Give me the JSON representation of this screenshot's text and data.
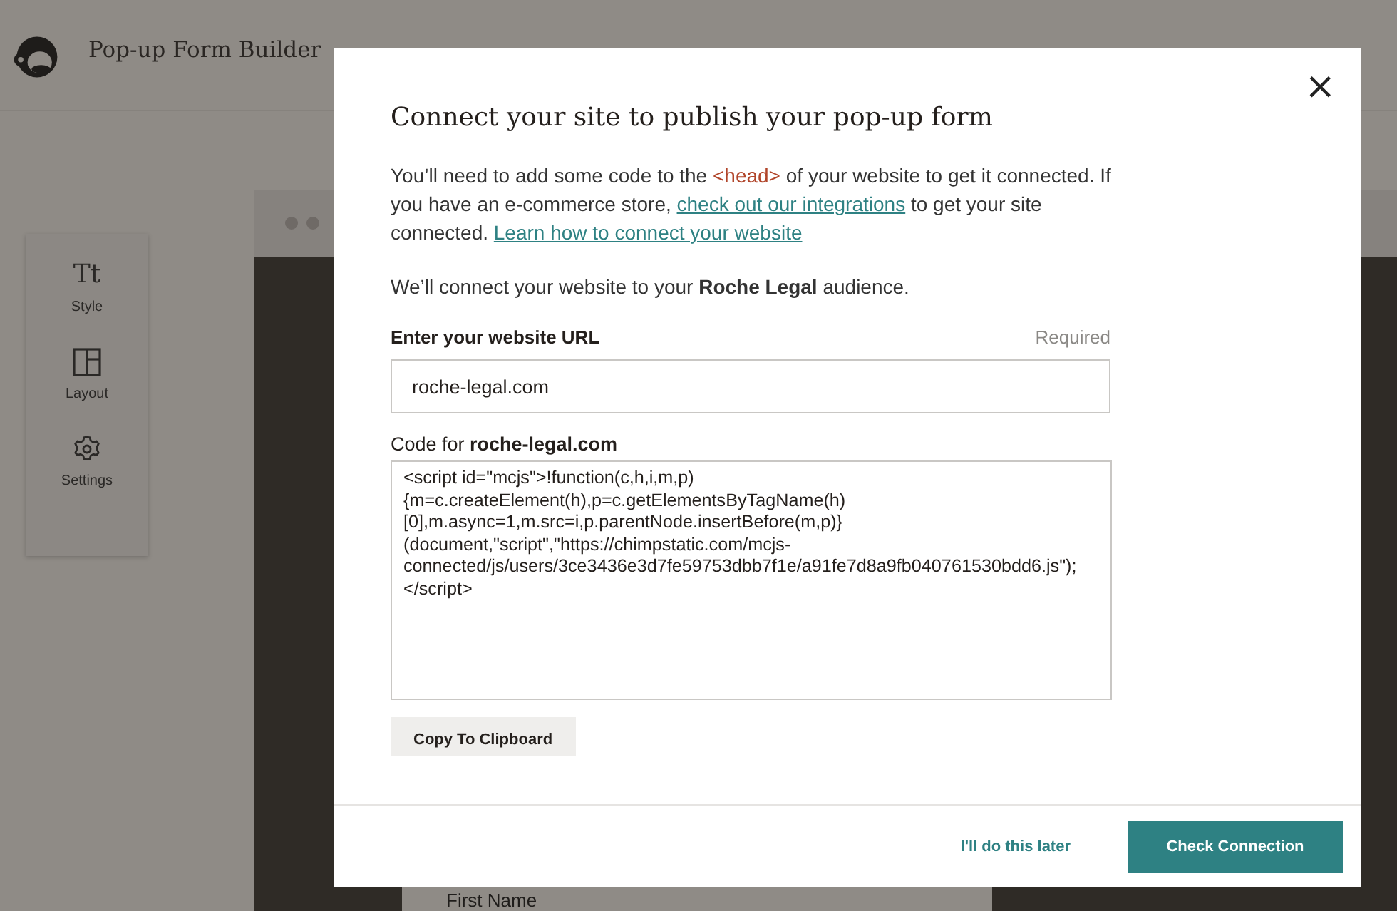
{
  "app": {
    "title": "Pop-up Form Builder"
  },
  "sidebar": {
    "items": [
      {
        "kind": "style",
        "label": "Style",
        "icon_text": "Tt"
      },
      {
        "kind": "layout",
        "label": "Layout"
      },
      {
        "kind": "settings",
        "label": "Settings"
      }
    ]
  },
  "preview": {
    "field_label": "First Name"
  },
  "modal": {
    "title": "Connect your site to publish your pop-up form",
    "close": "×",
    "intro": [
      {
        "kind": "text",
        "text": "You’ll need to add some code to the "
      },
      {
        "kind": "code",
        "text": "<head>"
      },
      {
        "kind": "text",
        "text": " of your website to get it connected. If you have an e-commerce store, "
      },
      {
        "kind": "link",
        "text": "check out our integrations"
      },
      {
        "kind": "text",
        "text": " to get your site connected. "
      },
      {
        "kind": "link",
        "text": "Learn how to connect your website"
      }
    ],
    "audience_note": "We’ll connect your website to your **Roche Legal** audience.",
    "url_field": {
      "label": "Enter your website URL",
      "required": "Required",
      "value": "roche-legal.com"
    },
    "code_field": {
      "label": "Code for **roche-legal.com**",
      "value": "<script id=\"mcjs\">!function(c,h,i,m,p){m=c.createElement(h),p=c.getElementsByTagName(h)[0],m.async=1,m.src=i,p.parentNode.insertBefore(m,p)}(document,\"script\",\"https://chimpstatic.com/mcjs-connected/js/users/3ce3436e3d7fe59753dbb7f1e/a91fe7d8a9fb040761530bdd6.js\");</script>"
    },
    "copy_button": "Copy To Clipboard",
    "later_link": "I'll do this later",
    "check_button": "Check Connection"
  }
}
